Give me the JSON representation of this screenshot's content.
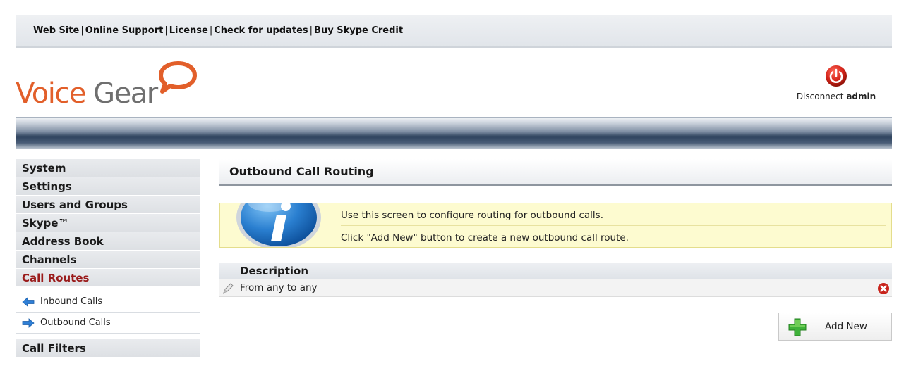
{
  "top_links": [
    "Web Site",
    "Online Support",
    "License",
    "Check for updates",
    "Buy Skype Credit"
  ],
  "logo": {
    "word1": "Voice",
    "word2": "Gear",
    "icon": "speech-bubble-icon"
  },
  "header": {
    "disconnect_label": "Disconnect",
    "user": "admin",
    "icon": "power-icon"
  },
  "sidebar": {
    "items": [
      "System",
      "Settings",
      "Users and Groups",
      "Skype™",
      "Address Book",
      "Channels",
      "Call Routes"
    ],
    "active_item": "Call Routes",
    "subitems": [
      "Inbound Calls",
      "Outbound Calls"
    ],
    "after": "Call Filters"
  },
  "main": {
    "title": "Outbound Call Routing",
    "info": {
      "line1": "Use this screen to configure routing for outbound calls.",
      "line2": "Click \"Add New\" button to create a new outbound call route."
    },
    "table": {
      "header": "Description",
      "rows": [
        "From any to any"
      ]
    },
    "add_new_label": "Add New"
  },
  "colors": {
    "accent": "#e25f2a",
    "active": "#9a1b1b",
    "info_bg": "#fdfbd0"
  }
}
